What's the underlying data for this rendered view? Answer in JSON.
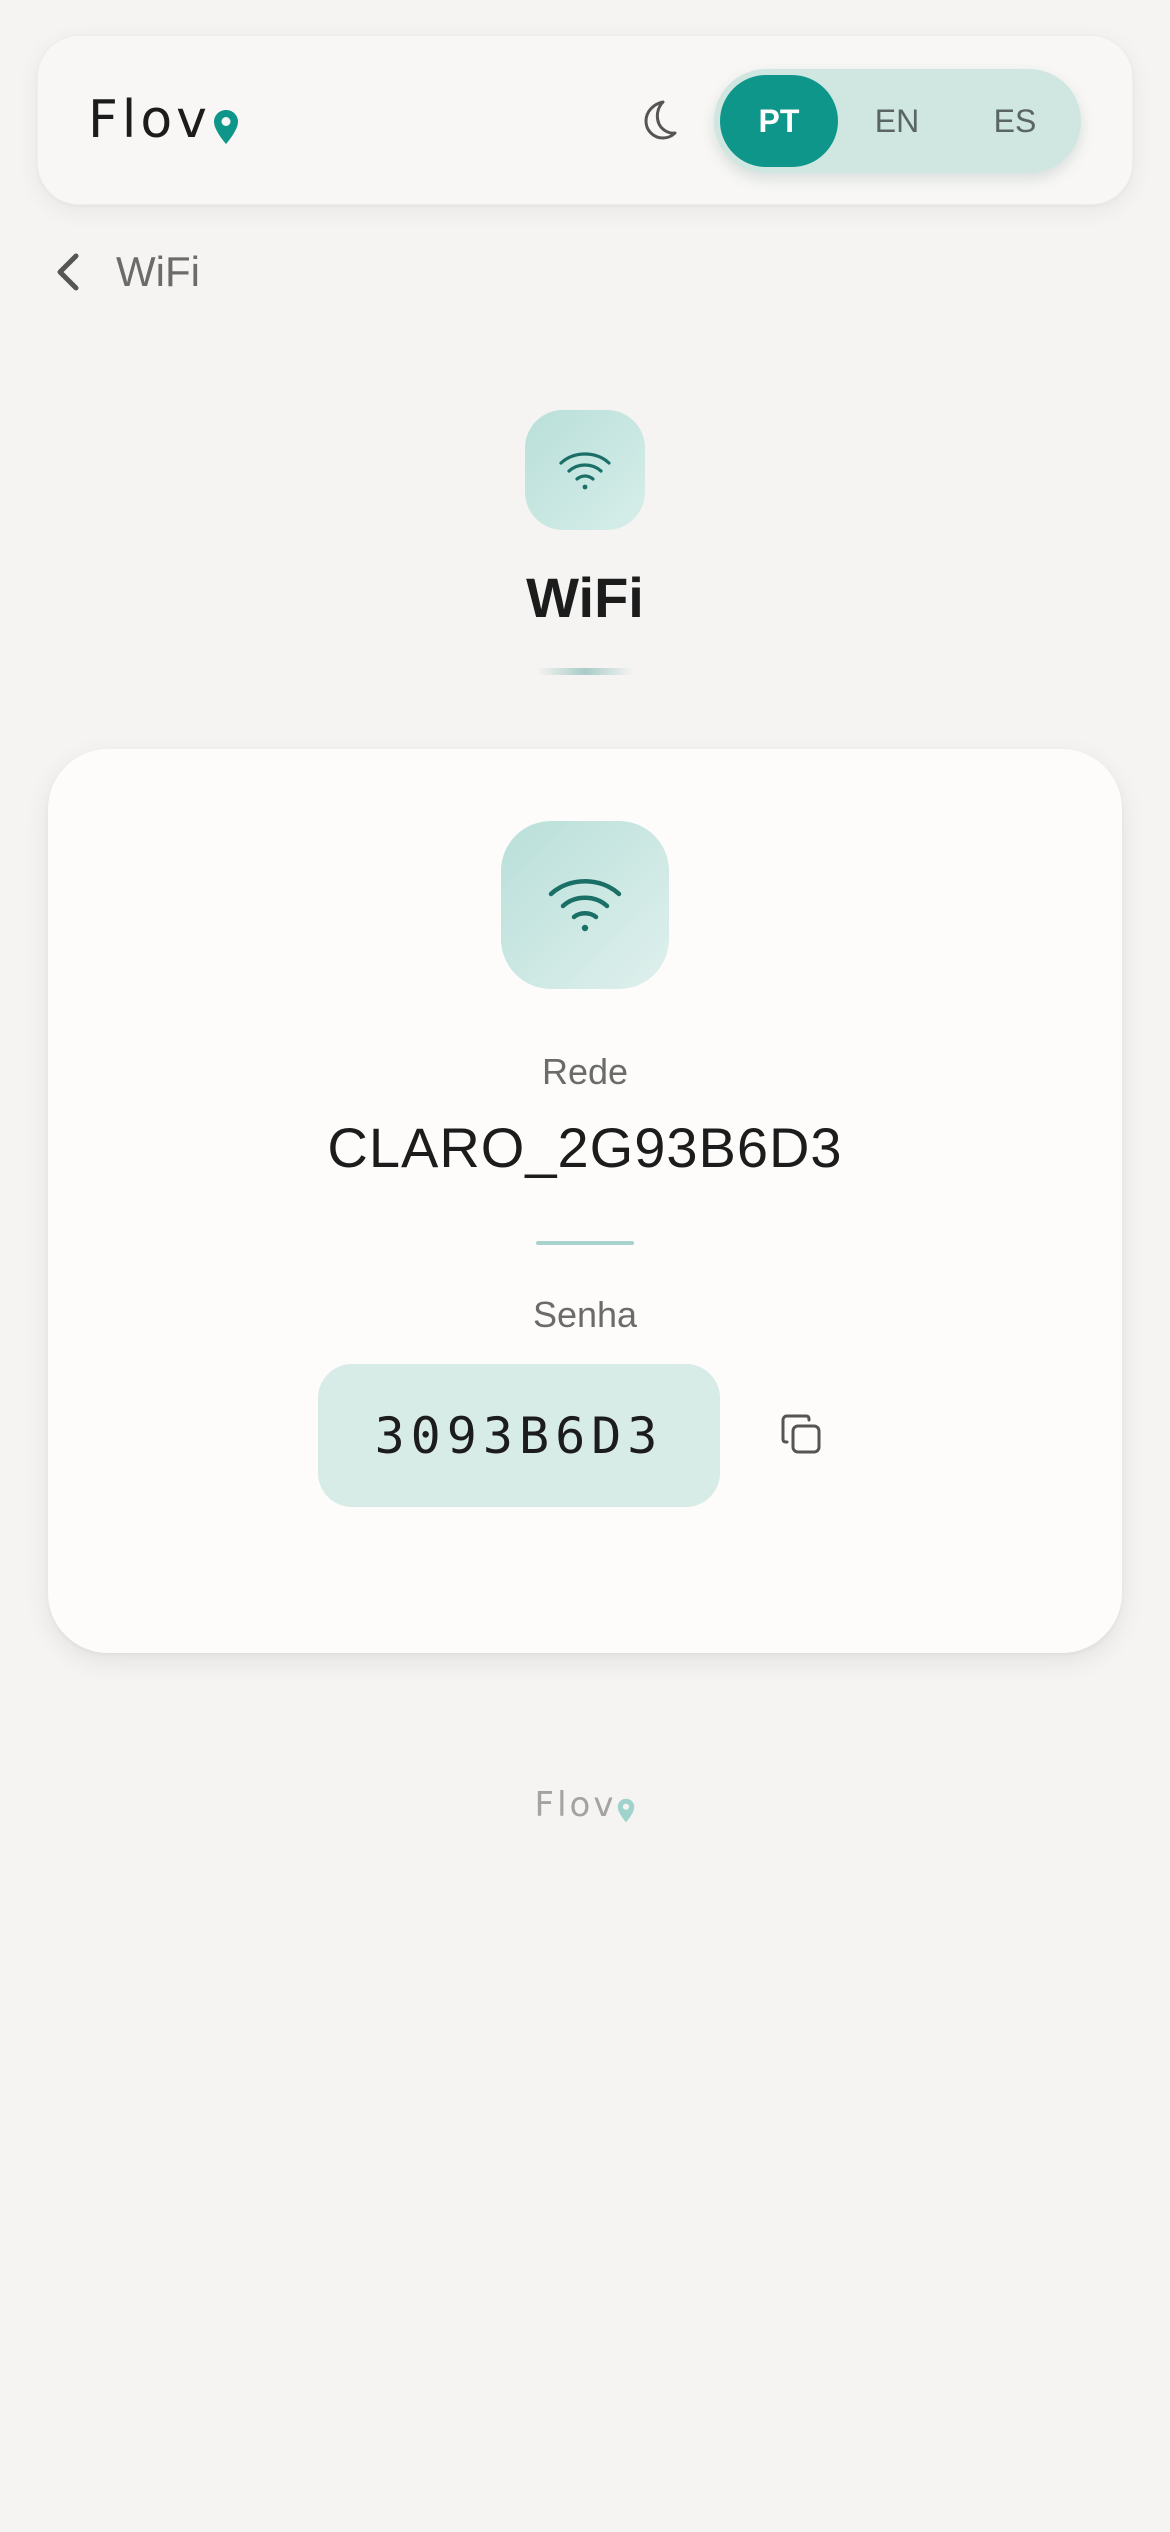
{
  "header": {
    "logo_text": "Flov",
    "languages": [
      {
        "code": "PT",
        "active": true
      },
      {
        "code": "EN",
        "active": false
      },
      {
        "code": "ES",
        "active": false
      }
    ]
  },
  "breadcrumb": {
    "label": "WiFi"
  },
  "page": {
    "title": "WiFi"
  },
  "card": {
    "network_label": "Rede",
    "network_name": "CLARO_2G93B6D3",
    "password_label": "Senha",
    "password_value": "3093B6D3"
  },
  "footer": {
    "logo_text": "Flov"
  },
  "colors": {
    "accent": "#0f968a",
    "accent_soft": "#cfe6e1",
    "icon_stroke": "#1a6f66",
    "background": "#f5f4f2"
  }
}
